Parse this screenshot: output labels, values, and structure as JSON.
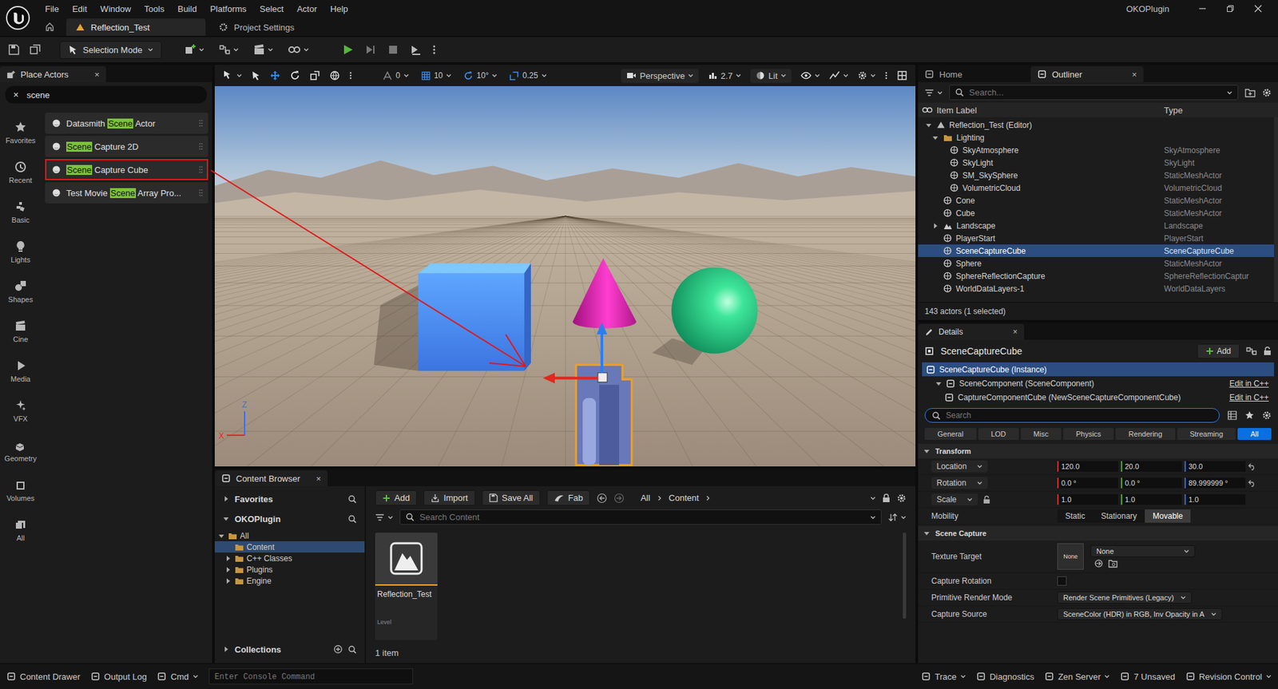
{
  "app": {
    "project": "OKOPlugin"
  },
  "menu": [
    "File",
    "Edit",
    "Window",
    "Tools",
    "Build",
    "Platforms",
    "Select",
    "Actor",
    "Help"
  ],
  "doc_tabs": [
    {
      "label": "Reflection_Test",
      "kind": "level",
      "selected": true
    },
    {
      "label": "Project Settings",
      "kind": "settings",
      "selected": false
    }
  ],
  "toolbar": {
    "mode": "Selection Mode"
  },
  "place_actors": {
    "title": "Place Actors",
    "close": "×",
    "search": "scene",
    "clear": "×",
    "categories": [
      {
        "label": "Favorites",
        "kind": "favorites"
      },
      {
        "label": "Recent",
        "kind": "recent"
      },
      {
        "label": "Basic",
        "kind": "basic"
      },
      {
        "label": "Lights",
        "kind": "lights"
      },
      {
        "label": "Shapes",
        "kind": "shapes"
      },
      {
        "label": "Cine",
        "kind": "cine"
      },
      {
        "label": "Media",
        "kind": "media"
      },
      {
        "label": "VFX",
        "kind": "vfx"
      },
      {
        "label": "Geometry",
        "kind": "geometry"
      },
      {
        "label": "Volumes",
        "kind": "volumes"
      },
      {
        "label": "All",
        "kind": "all"
      }
    ],
    "results": [
      {
        "label": "Datasmith Scene Actor",
        "annotated": false
      },
      {
        "label": "Scene Capture 2D",
        "annotated": false
      },
      {
        "label": "Scene Capture Cube",
        "annotated": true
      },
      {
        "label": "Test Movie Scene Array Pro...",
        "annotated": false
      }
    ]
  },
  "viewport": {
    "snaps": [
      {
        "value": "0",
        "kind": "surface",
        "on": false
      },
      {
        "value": "10",
        "kind": "grid",
        "on": true
      },
      {
        "value": "10°",
        "kind": "rotate",
        "on": true
      },
      {
        "value": "0.25",
        "kind": "scale",
        "on": true
      }
    ],
    "view": "Perspective",
    "speed": "2.7",
    "mode": "Lit",
    "axes": {
      "up": "Z",
      "side": "X"
    }
  },
  "outliner": {
    "tabs": [
      {
        "label": "Home",
        "selected": false
      },
      {
        "label": "Outliner",
        "selected": true
      }
    ],
    "close": "×",
    "search": "Search...",
    "columns": [
      "Item Label",
      "Type"
    ],
    "rows": [
      {
        "label": "Reflection_Test (Editor)",
        "depth": 0,
        "kind": "level",
        "expandable": true,
        "expanded": true,
        "selected": false
      },
      {
        "label": "Lighting",
        "depth": 1,
        "kind": "folder",
        "expandable": true,
        "expanded": true,
        "selected": false
      },
      {
        "label": "SkyAtmosphere",
        "type": "SkyAtmosphere",
        "depth": 2,
        "kind": "actor",
        "expandable": false,
        "expanded": false,
        "selected": false
      },
      {
        "label": "SkyLight",
        "type": "SkyLight",
        "depth": 2,
        "kind": "actor",
        "expandable": false,
        "expanded": false,
        "selected": false
      },
      {
        "label": "SM_SkySphere",
        "type": "StaticMeshActor",
        "depth": 2,
        "kind": "actor",
        "expandable": false,
        "expanded": false,
        "selected": false
      },
      {
        "label": "VolumetricCloud",
        "type": "VolumetricCloud",
        "depth": 2,
        "kind": "actor",
        "expandable": false,
        "expanded": false,
        "selected": false
      },
      {
        "label": "Cone",
        "type": "StaticMeshActor",
        "depth": 1,
        "kind": "actor",
        "expandable": false,
        "expanded": false,
        "selected": false
      },
      {
        "label": "Cube",
        "type": "StaticMeshActor",
        "depth": 1,
        "kind": "actor",
        "expandable": false,
        "expanded": false,
        "selected": false
      },
      {
        "label": "Landscape",
        "type": "Landscape",
        "depth": 1,
        "kind": "landscape",
        "expandable": true,
        "expanded": false,
        "selected": false
      },
      {
        "label": "PlayerStart",
        "type": "PlayerStart",
        "depth": 1,
        "kind": "actor",
        "expandable": false,
        "expanded": false,
        "selected": false
      },
      {
        "label": "SceneCaptureCube",
        "type": "SceneCaptureCube",
        "depth": 1,
        "kind": "actor",
        "expandable": false,
        "expanded": false,
        "selected": true
      },
      {
        "label": "Sphere",
        "type": "StaticMeshActor",
        "depth": 1,
        "kind": "actor",
        "expandable": false,
        "expanded": false,
        "selected": false
      },
      {
        "label": "SphereReflectionCapture",
        "type": "SphereReflectionCaptur",
        "depth": 1,
        "kind": "actor",
        "expandable": false,
        "expanded": false,
        "selected": false
      },
      {
        "label": "WorldDataLayers-1",
        "type": "WorldDataLayers",
        "depth": 1,
        "kind": "actor",
        "expandable": false,
        "expanded": false,
        "selected": false
      }
    ],
    "footer": "143 actors (1 selected)"
  },
  "details": {
    "tab": "Details",
    "close": "×",
    "title": "SceneCaptureCube",
    "add": "Add",
    "components": [
      {
        "label": "SceneCaptureCube (Instance)",
        "depth": 0,
        "selected": true
      },
      {
        "label": "SceneComponent (SceneComponent)",
        "depth": 1,
        "selected": false,
        "action": "Edit in C++"
      },
      {
        "label": "CaptureComponentCube (NewSceneCaptureComponentCube)",
        "depth": 2,
        "selected": false,
        "action": "Edit in C++"
      }
    ],
    "search": {
      "placeholder": "Search",
      "focused": true
    },
    "filters": [
      {
        "label": "General",
        "selected": false
      },
      {
        "label": "LOD",
        "selected": false
      },
      {
        "label": "Misc",
        "selected": false
      },
      {
        "label": "Physics",
        "selected": false
      },
      {
        "label": "Rendering",
        "selected": false
      },
      {
        "label": "Streaming",
        "selected": false
      },
      {
        "label": "All",
        "selected": true
      }
    ],
    "transform": {
      "title": "Transform",
      "rows": [
        {
          "label": "Location",
          "values": [
            "120.0",
            "20.0",
            "30.0"
          ],
          "lock": false,
          "reset": true
        },
        {
          "label": "Rotation",
          "values": [
            "0.0 °",
            "0.0 °",
            "89.999999 °"
          ],
          "lock": false,
          "reset": true
        },
        {
          "label": "Scale",
          "values": [
            "1.0",
            "1.0",
            "1.0"
          ],
          "lock": true,
          "reset": false
        }
      ],
      "mobility": {
        "label": "Mobility",
        "options": [
          {
            "label": "Static",
            "selected": false
          },
          {
            "label": "Stationary",
            "selected": false
          },
          {
            "label": "Movable",
            "selected": true
          }
        ]
      }
    },
    "scene_capture": {
      "title": "Scene Capture",
      "rows": [
        {
          "kind": "texture",
          "label": "Texture Target",
          "thumb": "None",
          "value": "None"
        },
        {
          "kind": "checkbox",
          "label": "Capture Rotation",
          "checked": false
        },
        {
          "kind": "dropdown",
          "label": "Primitive Render Mode",
          "value": "Render Scene Primitives (Legacy)"
        },
        {
          "kind": "dropdown",
          "label": "Capture Source",
          "value": "SceneColor (HDR) in RGB, Inv Opacity in A"
        }
      ]
    }
  },
  "content_browser": {
    "title": "Content Browser",
    "close": "×",
    "favorites": "Favorites",
    "project": "OKOPlugin",
    "tree": [
      {
        "label": "All",
        "depth": 0,
        "expandable": true,
        "expanded": true,
        "selected": false
      },
      {
        "label": "Content",
        "depth": 1,
        "expandable": false,
        "expanded": false,
        "selected": true
      },
      {
        "label": "C++ Classes",
        "depth": 1,
        "expandable": true,
        "expanded": false,
        "selected": false
      },
      {
        "label": "Plugins",
        "depth": 1,
        "expandable": true,
        "expanded": false,
        "selected": false
      },
      {
        "label": "Engine",
        "depth": 1,
        "expandable": true,
        "expanded": false,
        "selected": false
      }
    ],
    "collections": "Collections",
    "buttons": [
      {
        "label": "Add",
        "kind": "add"
      },
      {
        "label": "Import",
        "kind": "import"
      },
      {
        "label": "Save All",
        "kind": "save"
      },
      {
        "label": "Fab",
        "kind": "fab"
      }
    ],
    "path": [
      "All",
      "Content"
    ],
    "search": "Search Content",
    "assets": [
      {
        "name": "Reflection_Test",
        "type": "Level"
      }
    ],
    "count": "1 item"
  },
  "status_bar": {
    "left": [
      {
        "label": "Content Drawer",
        "dropdown": false
      },
      {
        "label": "Output Log",
        "dropdown": false
      },
      {
        "label": "Cmd",
        "dropdown": true
      }
    ],
    "console": "Enter Console Command",
    "right": [
      {
        "label": "Trace",
        "dropdown": true
      },
      {
        "label": "Diagnostics",
        "dropdown": false
      },
      {
        "label": "Zen Server",
        "dropdown": true
      },
      {
        "label": "7 Unsaved",
        "dropdown": false
      },
      {
        "label": "Revision Control",
        "dropdown": true
      }
    ]
  }
}
